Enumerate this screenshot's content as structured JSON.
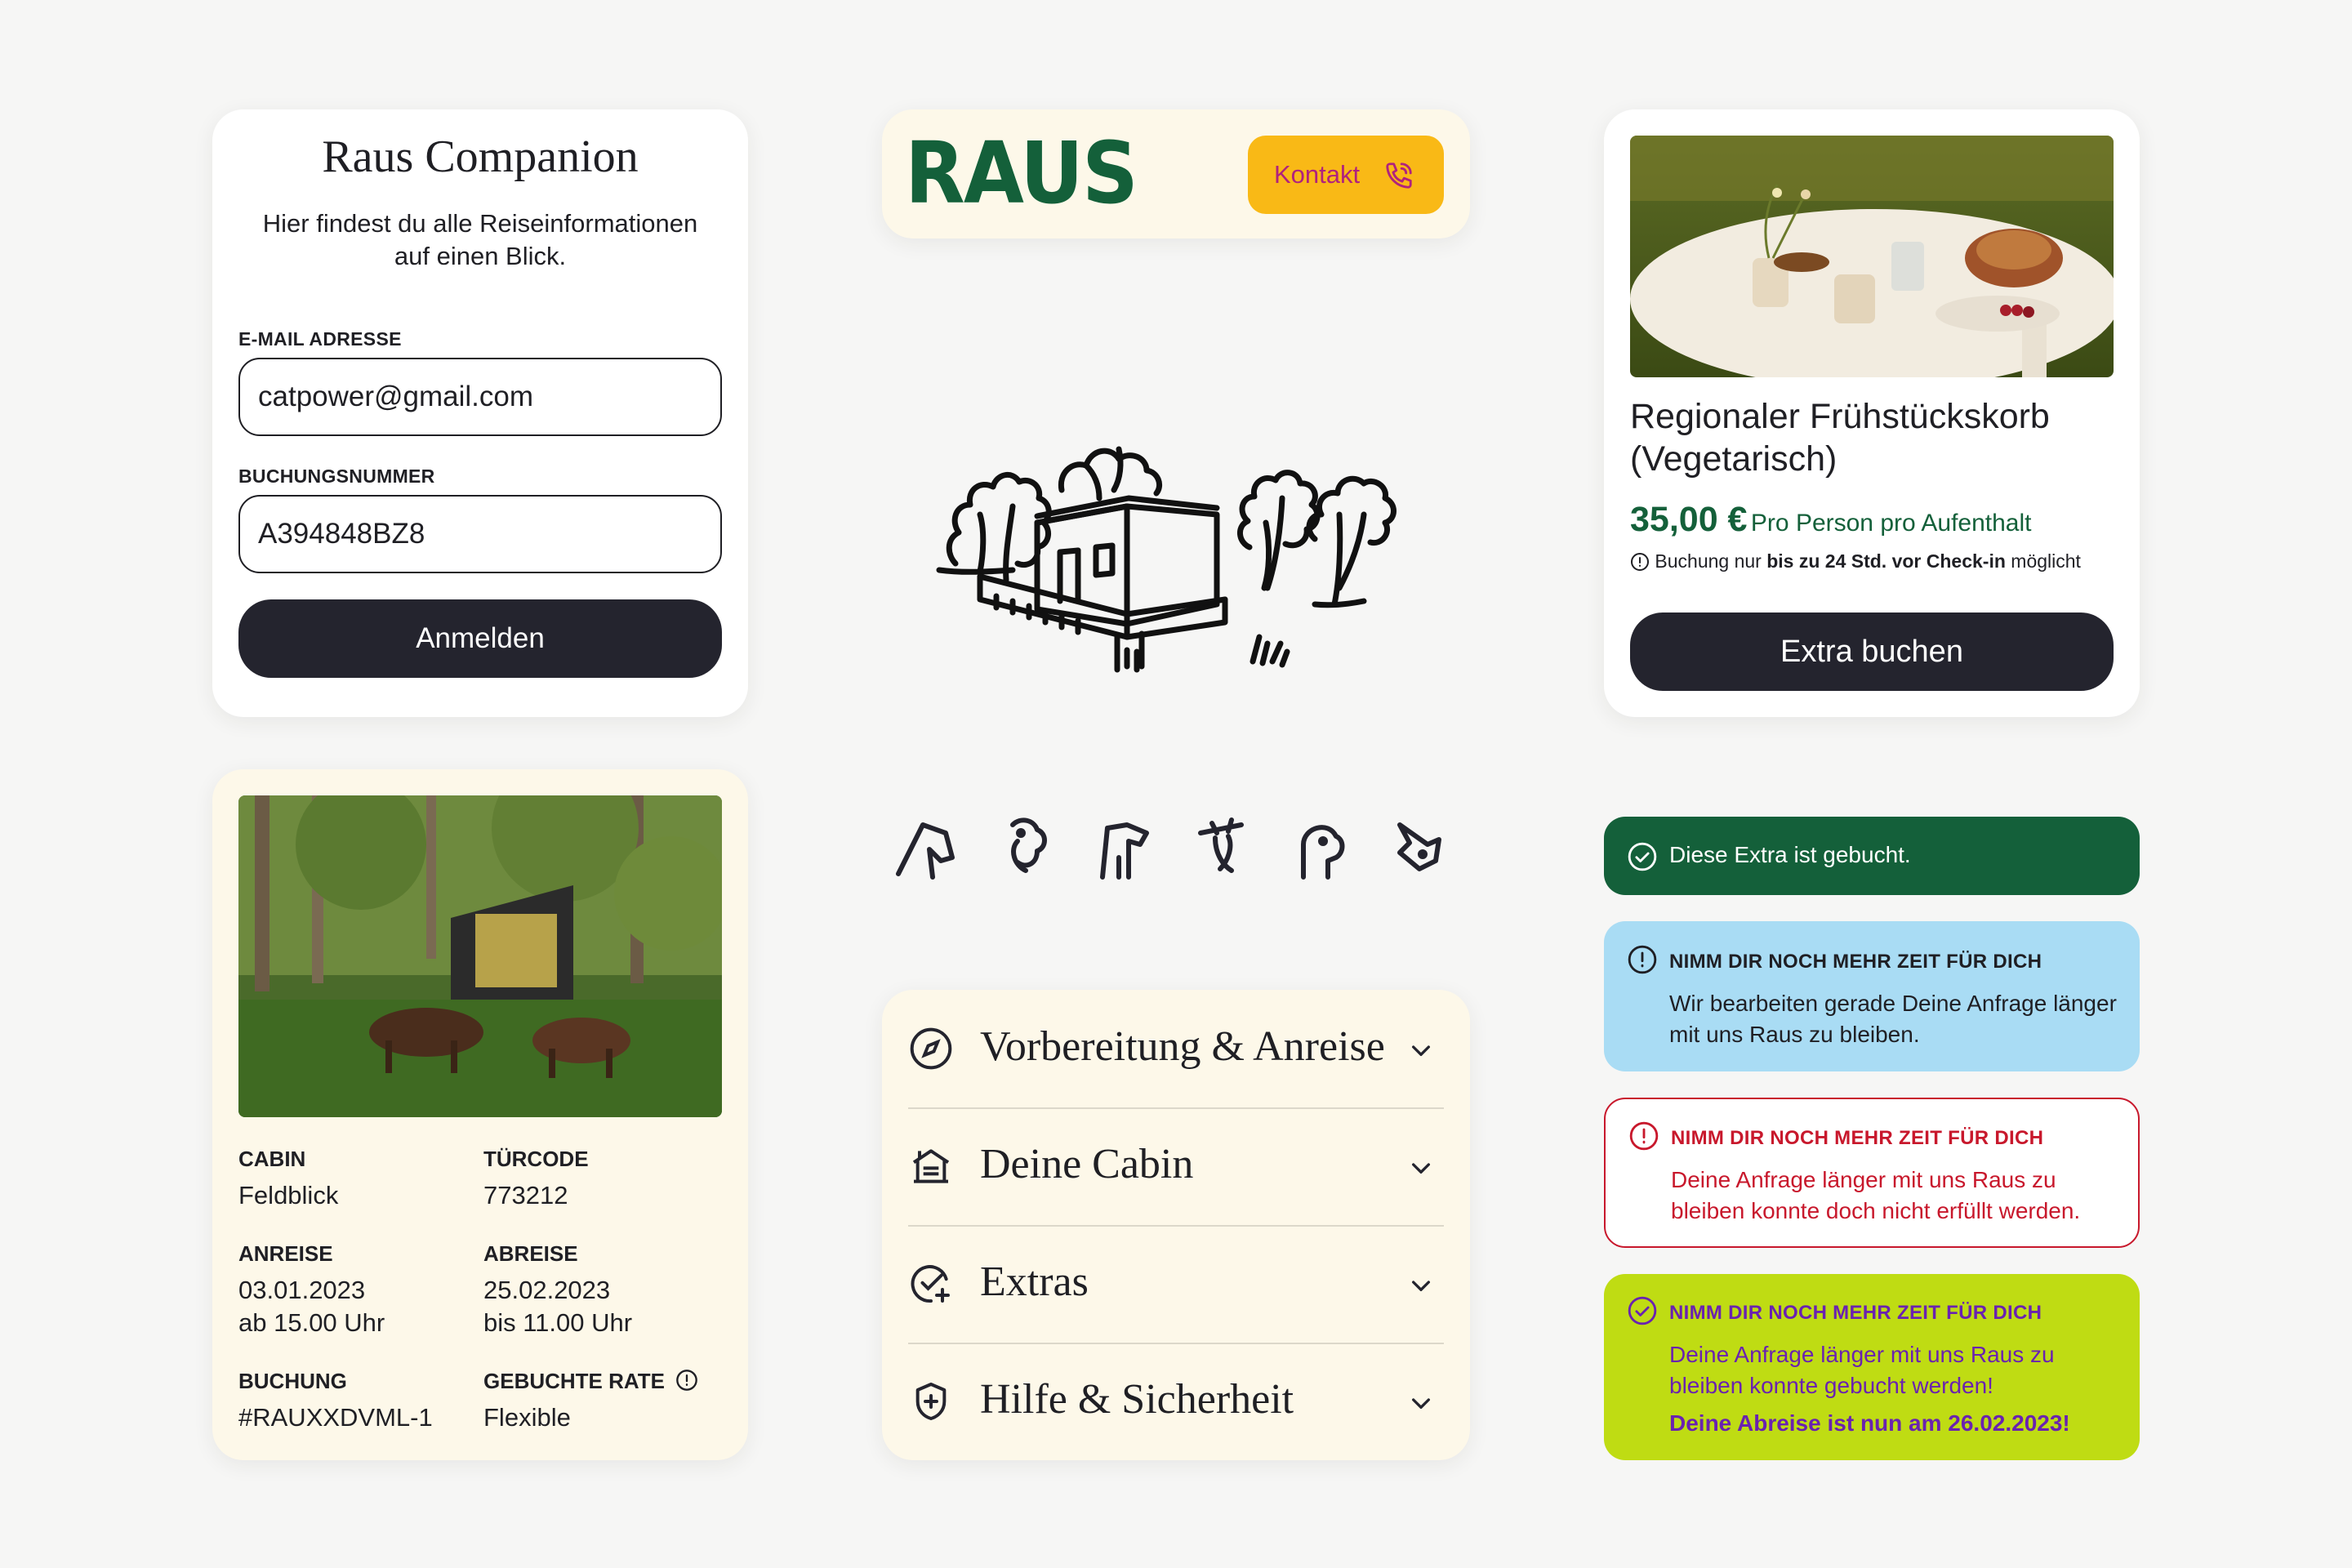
{
  "login": {
    "title": "Raus Companion",
    "subtitle": "Hier findest du alle Reiseinformationen auf einen Blick.",
    "email_label": "E-MAIL ADRESSE",
    "email_value": "catpower@gmail.com",
    "booking_label": "BUCHUNGSNUMMER",
    "booking_value": "A394848BZ8",
    "submit_label": "Anmelden"
  },
  "header": {
    "logo": "RAUS",
    "contact_label": "Kontakt",
    "contact_icon": "phone-icon"
  },
  "product": {
    "title": "Regionaler Frühstückskorb (Vegetarisch)",
    "price": "35,00 €",
    "price_unit": "Pro Person pro Aufenthalt",
    "note_prefix": "Buchung nur ",
    "note_bold": "bis zu 24 Std. vor Check-in",
    "note_suffix": " möglicht",
    "button_label": "Extra buchen"
  },
  "booking": {
    "cabin_label": "CABIN",
    "cabin_value": "Feldblick",
    "door_label": "TÜRCODE",
    "door_value": "773212",
    "arrival_label": "ANREISE",
    "arrival_date": "03.01.2023",
    "arrival_time": "ab 15.00 Uhr",
    "departure_label": "ABREISE",
    "departure_date": "25.02.2023",
    "departure_time": "bis 11.00 Uhr",
    "booking_label": "BUCHUNG",
    "booking_value": "#RAUXXDVML-1",
    "rate_label": "GEBUCHTE RATE",
    "rate_value": "Flexible"
  },
  "accordion": [
    {
      "label": "Vorbereitung & Anreise",
      "icon": "compass-icon"
    },
    {
      "label": "Deine Cabin",
      "icon": "cabin-icon"
    },
    {
      "label": "Extras",
      "icon": "check-plus-icon"
    },
    {
      "label": "Hilfe & Sicherheit",
      "icon": "shield-plus-icon"
    }
  ],
  "alerts": {
    "success": "Diese Extra ist gebucht.",
    "info_head": "NIMM DIR NOCH MEHR ZEIT FÜR DICH",
    "info_body": "Wir bearbeiten gerade Deine Anfrage länger mit uns Raus zu bleiben.",
    "error_head": "NIMM DIR NOCH MEHR ZEIT FÜR DICH",
    "error_body": "Deine Anfrage länger mit uns Raus zu bleiben konnte doch nicht erfüllt werden.",
    "lime_head": "NIMM DIR NOCH MEHR ZEIT FÜR DICH",
    "lime_body": "Deine Anfrage länger mit uns Raus zu bleiben konnte gebucht werden!",
    "lime_bold": "Deine Abreise ist nun am 26.02.2023!"
  },
  "colors": {
    "brand_green": "#14603a",
    "accent_yellow": "#f9b916",
    "accent_magenta": "#b0227d",
    "dark_button": "#24242e",
    "info_blue": "#a9dcf4",
    "error_red": "#c8182c",
    "lime": "#bfdc13",
    "purple": "#6a22b0",
    "cream": "#fdf8e9"
  }
}
